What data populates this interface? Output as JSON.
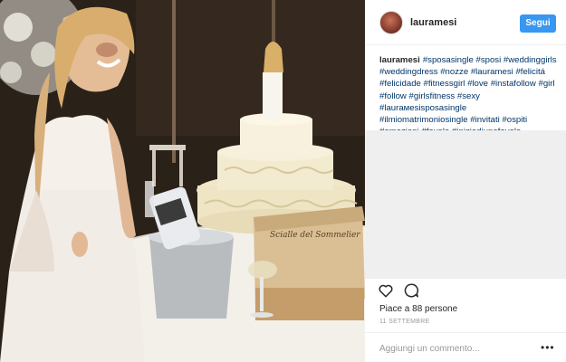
{
  "post": {
    "photo": {
      "icon": "wedding-photo"
    },
    "header": {
      "username": "lauramesi",
      "follow_label": "Segui"
    },
    "caption": {
      "username": "lauramesi",
      "hashtags": [
        "#sposasingle",
        "#sposi",
        "#weddinggirls",
        "#weddingdress",
        "#nozze",
        "#lauramesi",
        "#felicitá",
        "#felicidade",
        "#fitnessgirl",
        "#love",
        "#instafollow",
        "#girl",
        "#follow",
        "#girlsfitness",
        "#sexy",
        "#laurамesisposasingle",
        "#ilmiomatrimoniosingle",
        "#invitati",
        "#ospiti",
        "#emozioni",
        "#favola",
        "#iniziodiunafavola"
      ]
    },
    "actions": {
      "like_icon": "heart-icon",
      "comment_icon": "comment-icon"
    },
    "likes_text": "Piace a 88 persone",
    "date_text": "11 SETTEMBRE",
    "comment": {
      "placeholder": "Aggiungi un commento...",
      "more_icon": "more-options-icon",
      "more_glyph": "•••"
    },
    "cake_plaque_text": "Scialle del Sommelier"
  }
}
